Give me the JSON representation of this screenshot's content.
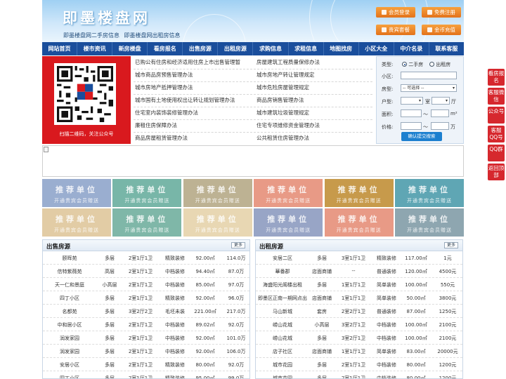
{
  "header": {
    "title": "即墨楼盘网",
    "subtitle": "即墨楼盘网二手房信息 即墨楼盘网出租房信息",
    "buttons": [
      {
        "label": "会员登录",
        "icon": "user-icon"
      },
      {
        "label": "免费注册",
        "icon": "register-icon"
      },
      {
        "label": "贵宾套餐",
        "icon": "vip-icon"
      },
      {
        "label": "金币充值",
        "icon": "coin-icon"
      }
    ]
  },
  "nav": [
    "网站首页",
    "楼市资讯",
    "新房楼盘",
    "看房报名",
    "出售房源",
    "出租房源",
    "求购信息",
    "求租信息",
    "地图找房",
    "小区大全",
    "中介名录",
    "联系客服"
  ],
  "qr": {
    "caption": "扫描二维码，关注公众号"
  },
  "news": {
    "left": [
      "已购公有住房和经济适用住房上市出售管理暂",
      "城市商品房预售管理办法",
      "城市房地产抵押管理办法",
      "城市国有土地使用权出让转让规划管理办法",
      "住宅室内装饰装修管理办法",
      "廉租住房保障办法",
      "商品房屋租赁管理办法"
    ],
    "right": [
      "房屋建筑工程质量保修办法",
      "城市房地产转让管理规定",
      "城市危险房屋管理规定",
      "商品房销售管理办法",
      "城市建筑垃圾管理规定",
      "住宅专项维修资金管理办法",
      "公共租赁住房管理办法"
    ]
  },
  "search": {
    "type_label": "类型:",
    "type_options": [
      "二手房",
      "出租房"
    ],
    "community_label": "小区:",
    "house_type_label": "房型:",
    "house_type_select": "-- 可选择 --",
    "layout_label": "户型:",
    "room_unit": "室",
    "hall_unit": "厅",
    "area_label": "面积:",
    "area_sep": "〜",
    "area_unit": "m²",
    "price_label": "价格:",
    "price_sep": "〜",
    "price_unit": "万",
    "submit": "确认提交搜索"
  },
  "tiles": {
    "title": "推荐单位",
    "subtitle": "开通贵宾会员赠送",
    "colors": [
      "#9aaed0",
      "#78b6a8",
      "#bdb293",
      "#e89a86",
      "#c79a4b",
      "#5fa6b4",
      "#e2cca5",
      "#7fb7a8",
      "#e8d7b3",
      "#98a5c6",
      "#e89a86",
      "#8ea6b0"
    ]
  },
  "sale": {
    "title": "出售房源",
    "more": "更多",
    "rows": [
      [
        "颐晖苑",
        "多层",
        "2室1厅1卫",
        "精致装修",
        "92.00㎡",
        "114.0万"
      ],
      [
        "信特紫薇苑",
        "高层",
        "2室1厅1卫",
        "中档装修",
        "94.40㎡",
        "87.0万"
      ],
      [
        "天一仁和景庭",
        "小高层",
        "2室1厅1卫",
        "中档装修",
        "85.00㎡",
        "97.0万"
      ],
      [
        "四丁小区",
        "多层",
        "2室1厅1卫",
        "精致装修",
        "92.00㎡",
        "96.0万"
      ],
      [
        "名都苑",
        "多层",
        "3室2厅2卫",
        "毛坯未装",
        "221.00㎡",
        "217.0万"
      ],
      [
        "中和居小区",
        "多层",
        "2室1厅1卫",
        "中档装修",
        "89.02㎡",
        "92.0万"
      ],
      [
        "润发家园",
        "多层",
        "2室1厅1卫",
        "中档装修",
        "92.00㎡",
        "101.0万"
      ],
      [
        "润发家园",
        "多层",
        "2室1厅1卫",
        "中档装修",
        "92.00㎡",
        "106.0万"
      ],
      [
        "安居小区",
        "多层",
        "2室1厅1卫",
        "精致装修",
        "80.00㎡",
        "92.0万"
      ],
      [
        "四丁小区",
        "多层",
        "2室1厅1卫",
        "精致装修",
        "95.00㎡",
        "99.0万"
      ]
    ]
  },
  "rent": {
    "title": "出租房源",
    "more": "更多",
    "rows": [
      [
        "安居二区",
        "多层",
        "3室1厅1卫",
        "精致装修",
        "117.00㎡",
        "1元"
      ],
      [
        "華番郡",
        "店面商铺",
        "--",
        "普通装修",
        "120.00㎡",
        "4500元"
      ],
      [
        "海盛阳光阁楼出租",
        "多层",
        "1室1厅1卫",
        "简单装修",
        "100.00㎡",
        "550元"
      ],
      [
        "即墨区正南一期网点出",
        "店面商铺",
        "1室1厅1卫",
        "简单装修",
        "50.00㎡",
        "3800元"
      ],
      [
        "马山新城",
        "套房",
        "2室2厅1卫",
        "普通装修",
        "87.00㎡",
        "1250元"
      ],
      [
        "崂山花城",
        "小高层",
        "3室2厅1卫",
        "中档装修",
        "100.00㎡",
        "2100元"
      ],
      [
        "崂山花城",
        "多层",
        "3室2厅1卫",
        "中档装修",
        "100.00㎡",
        "2100元"
      ],
      [
        "店子社区",
        "店面商铺",
        "1室1厅1卫",
        "简单装修",
        "83.00㎡",
        "20000元"
      ],
      [
        "城市花园",
        "多层",
        "2室1厅1卫",
        "中档装修",
        "80.00㎡",
        "1200元"
      ],
      [
        "城市花园",
        "多层",
        "2室1厅1卫",
        "中档装修",
        "80.00㎡",
        "1200元"
      ]
    ]
  },
  "float": [
    "看房报名",
    "客服微信",
    "公众号",
    "客服QQ号",
    "QQ群",
    "返回顶部"
  ]
}
